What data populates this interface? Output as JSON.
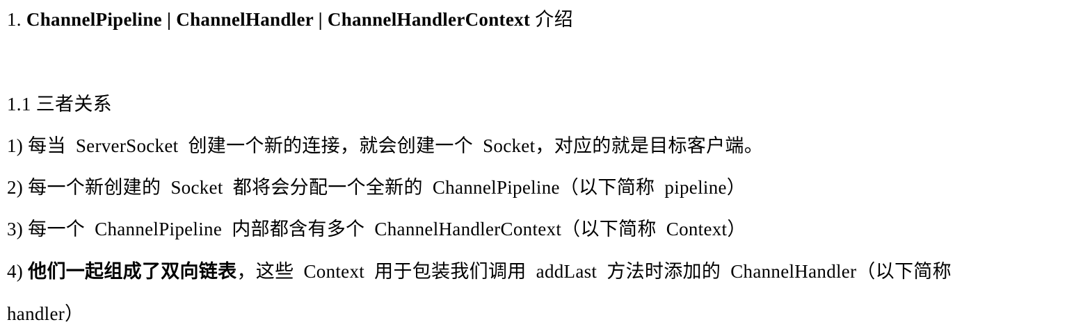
{
  "heading": {
    "number": "1.",
    "title": "ChannelPipeline | ChannelHandler | ChannelHandlerContext",
    "suffix": "介绍"
  },
  "section": {
    "number": "1.1",
    "title": "三者关系"
  },
  "items": [
    {
      "marker": "1)",
      "text": "每当  ServerSocket  创建一个新的连接，就会创建一个  Socket，对应的就是目标客户端。"
    },
    {
      "marker": "2)",
      "text": "每一个新创建的  Socket  都将会分配一个全新的  ChannelPipeline（以下简称  pipeline）"
    },
    {
      "marker": "3)",
      "text": "每一个  ChannelPipeline  内部都含有多个  ChannelHandlerContext（以下简称  Context）"
    },
    {
      "marker": "4)",
      "bold": "他们一起组成了双向链表",
      "text": "，这些  Context  用于包装我们调用  addLast  方法时添加的  ChannelHandler（以下简称",
      "continuation": "handler）"
    }
  ]
}
